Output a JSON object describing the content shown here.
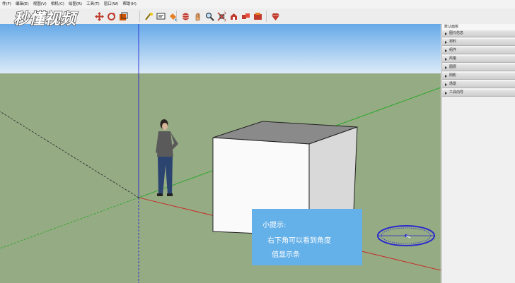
{
  "menu": [
    "件(F)",
    "编辑(E)",
    "视图(V)",
    "相机(C)",
    "绘图(R)",
    "工具(T)",
    "窗口(W)",
    "帮助(H)"
  ],
  "watermark": {
    "text": "秒懂视频"
  },
  "tray": {
    "title": "默认面板",
    "items": [
      "图元信息",
      "材料",
      "组件",
      "风格",
      "图层",
      "阴影",
      "场景",
      "工具向导"
    ]
  },
  "tip": {
    "title": "小提示:",
    "line1": "右下角可以看到角度",
    "line2": "值显示条"
  },
  "colors": {
    "sky_top": "#66a9e8",
    "sky_bottom": "#dcebf8",
    "ground": "#95ab84",
    "tip_bg": "#64b0e8",
    "axis_red": "#cc2222",
    "axis_green": "#22aa22",
    "axis_blue": "#2222cc"
  },
  "toolbar": {
    "icons": [
      "select-icon",
      "eraser-icon",
      "move-icon",
      "rotate-icon",
      "scale-icon",
      "tape-measure-icon",
      "text-icon",
      "paint-bucket-icon",
      "orbit-icon",
      "pan-icon",
      "zoom-icon",
      "zoom-extents-icon",
      "warehouse-icon",
      "components-icon",
      "extension-icon",
      "ruby-icon"
    ]
  }
}
